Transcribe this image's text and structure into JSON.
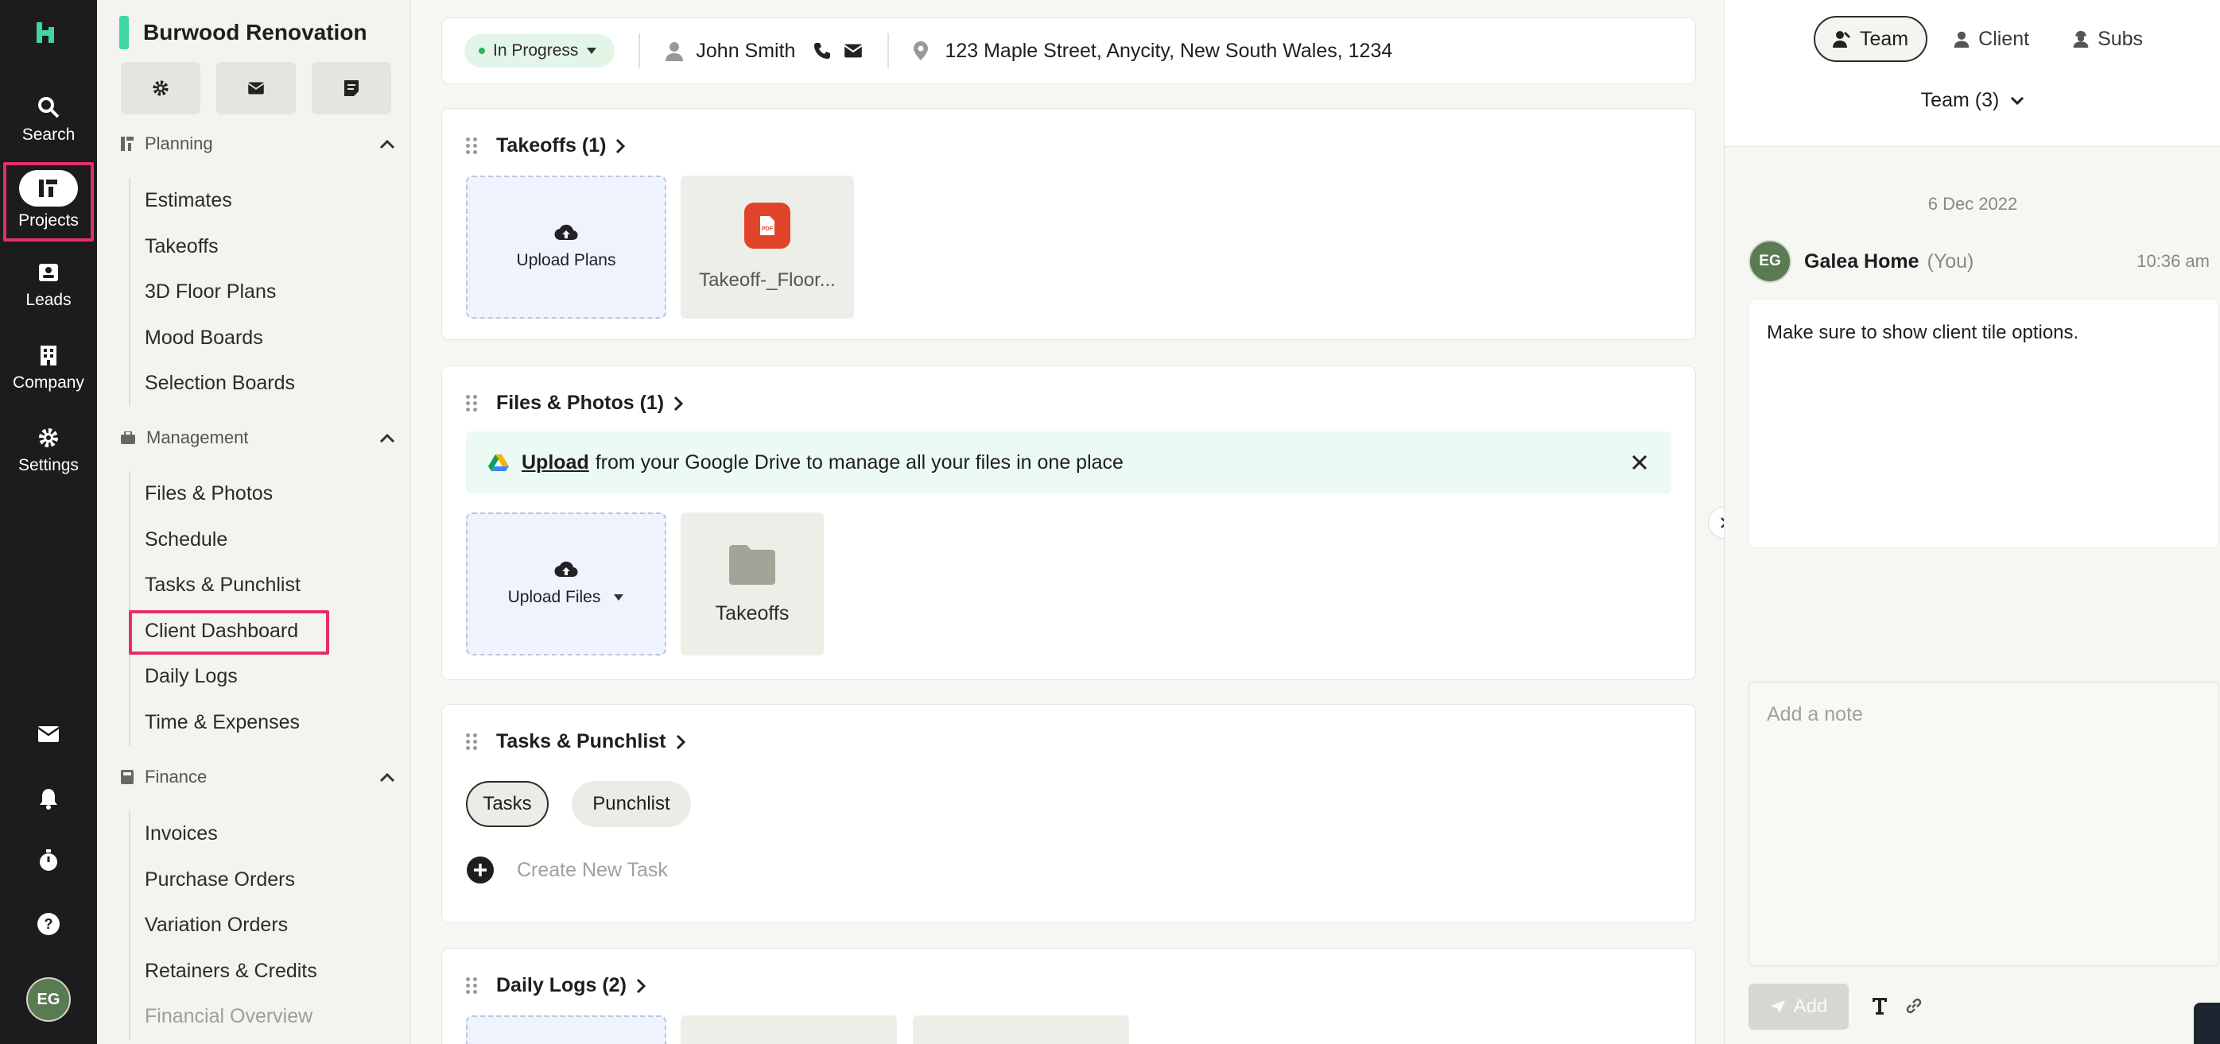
{
  "rail": {
    "items": [
      {
        "label": "Search",
        "icon": "search-icon"
      },
      {
        "label": "Projects",
        "icon": "projects-icon"
      },
      {
        "label": "Leads",
        "icon": "leads-icon"
      },
      {
        "label": "Company",
        "icon": "company-icon"
      },
      {
        "label": "Settings",
        "icon": "gear-icon"
      }
    ],
    "avatar_initials": "EG"
  },
  "sidebar": {
    "project_title": "Burwood Renovation",
    "sections": [
      {
        "title": "Planning",
        "items": [
          "Estimates",
          "Takeoffs",
          "3D Floor Plans",
          "Mood Boards",
          "Selection Boards"
        ]
      },
      {
        "title": "Management",
        "items": [
          "Files & Photos",
          "Schedule",
          "Tasks & Punchlist",
          "Client Dashboard",
          "Daily Logs",
          "Time & Expenses"
        ]
      },
      {
        "title": "Finance",
        "items": [
          "Invoices",
          "Purchase Orders",
          "Variation Orders",
          "Retainers & Credits",
          "Financial Overview"
        ]
      }
    ]
  },
  "info_bar": {
    "status": "In Progress",
    "client_name": "John Smith",
    "address": "123 Maple Street, Anycity, New South Wales, 1234"
  },
  "takeoffs": {
    "title": "Takeoffs (1)",
    "upload_label": "Upload Plans",
    "file_name": "Takeoff-_Floor..."
  },
  "files": {
    "title": "Files & Photos (1)",
    "banner_link": "Upload",
    "banner_text": "from your Google Drive to manage all your files in one place",
    "upload_label": "Upload Files",
    "folder_name": "Takeoffs"
  },
  "tasks": {
    "title": "Tasks & Punchlist",
    "tabs": [
      "Tasks",
      "Punchlist"
    ],
    "create_label": "Create New Task"
  },
  "daily_logs": {
    "title": "Daily Logs (2)"
  },
  "right_panel": {
    "tabs": [
      "Team",
      "Client",
      "Subs"
    ],
    "team_dropdown": "Team (3)",
    "date": "6 Dec 2022",
    "author": "Galea Home",
    "author_suffix": "(You)",
    "time": "10:36 am",
    "message": "Make sure to show client tile options.",
    "note_placeholder": "Add a note",
    "add_label": "Add"
  },
  "colors": {
    "highlight": "#e2306c",
    "brand_green": "#3ed6a3",
    "pdf_red": "#e0452a"
  }
}
